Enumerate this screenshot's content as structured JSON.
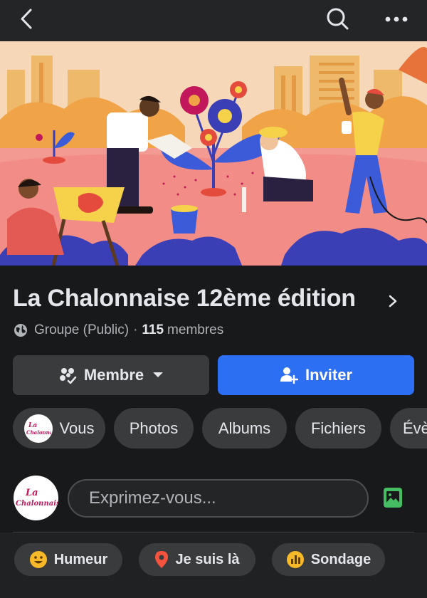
{
  "header": {
    "back_icon": "back-arrow-icon",
    "search_icon": "search-icon",
    "more_icon": "more-dots-icon"
  },
  "group": {
    "name": "La Chalonnaise 12ème édition",
    "privacy": "Groupe (Public)",
    "separator": "·",
    "member_count": "115",
    "member_word": "membres",
    "logo_text_line1": "La",
    "logo_text_line2": "Chalonnaise"
  },
  "buttons": {
    "member_label": "Membre",
    "invite_label": "Inviter"
  },
  "tabs": [
    {
      "label": "Vous"
    },
    {
      "label": "Photos"
    },
    {
      "label": "Albums"
    },
    {
      "label": "Fichiers"
    },
    {
      "label": "Évè"
    }
  ],
  "composer": {
    "placeholder": "Exprimez-vous..."
  },
  "actions": [
    {
      "label": "Humeur",
      "icon": "smiley-icon",
      "color": "#f7b928"
    },
    {
      "label": "Je suis là",
      "icon": "location-pin-icon",
      "color": "#f5533d"
    },
    {
      "label": "Sondage",
      "icon": "poll-icon",
      "color": "#f7b928"
    }
  ],
  "colors": {
    "background": "#18191a",
    "accent": "#2d6ff2",
    "chip": "#3a3b3c",
    "logo_magenta": "#c2185b"
  }
}
